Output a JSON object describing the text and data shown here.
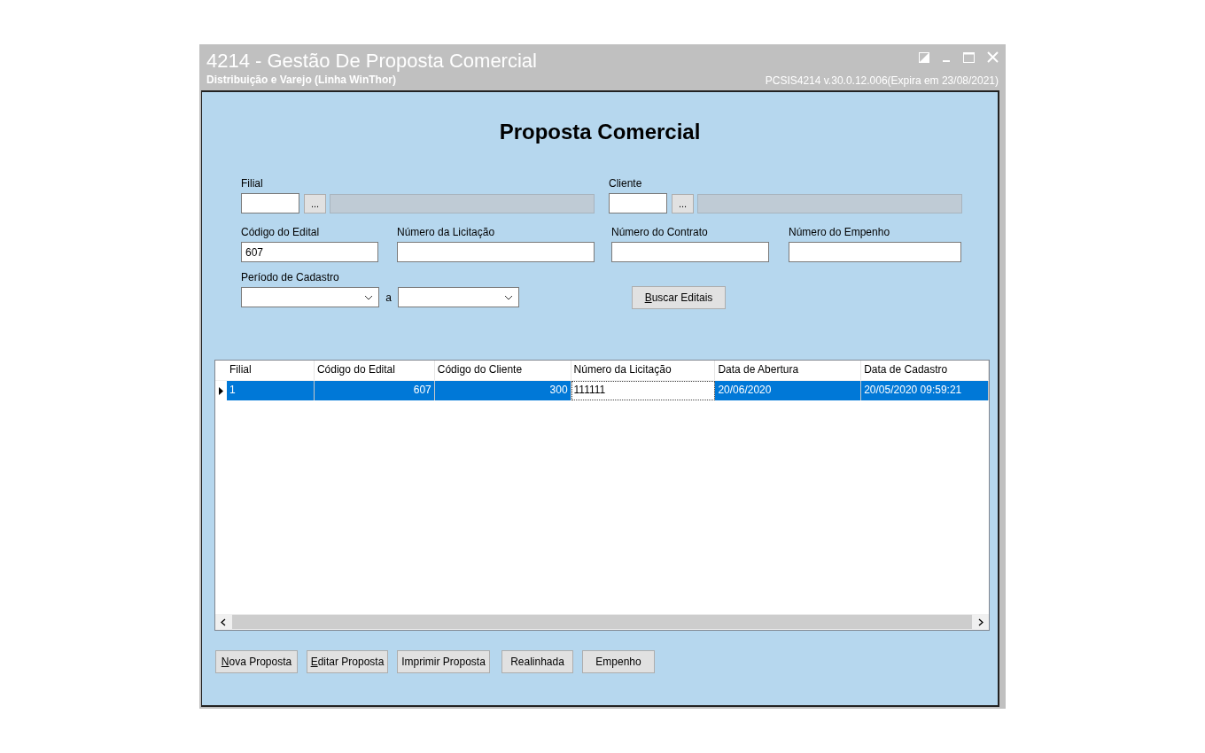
{
  "window": {
    "title": "4214 - Gestão De Proposta Comercial",
    "subtitle": "Distribuição e Varejo (Linha WinThor)",
    "version": "PCSIS4214  v.30.0.12.006(Expira em 23/08/2021)"
  },
  "heading": "Proposta Comercial",
  "lookups": [
    {
      "label": "Filial",
      "button": "..."
    },
    {
      "label": "Cliente",
      "button": "..."
    }
  ],
  "fields": [
    {
      "label": "Código do Edital",
      "value": "607"
    },
    {
      "label": "Número da Licitação"
    },
    {
      "label": "Número do Contrato"
    },
    {
      "label": "Número do Empenho"
    }
  ],
  "period": {
    "label": "Período de Cadastro",
    "separator": "a"
  },
  "search_button": {
    "label": "Buscar Editais",
    "accelerator": true
  },
  "table": {
    "columns": [
      {
        "label": "Filial",
        "kind": "text"
      },
      {
        "label": "Código do Edital",
        "kind": "number"
      },
      {
        "label": "Código do Cliente",
        "kind": "number"
      },
      {
        "label": "Número da Licitação",
        "kind": "text"
      },
      {
        "label": "Data de Abertura",
        "kind": "text"
      },
      {
        "label": "Data de Cadastro",
        "kind": "text"
      }
    ],
    "rows": [
      {
        "selected": true,
        "cells": [
          {
            "text": "1",
            "focused": false
          },
          {
            "text": "607",
            "focused": false
          },
          {
            "text": "300",
            "focused": false
          },
          {
            "text": "111111",
            "focused": true
          },
          {
            "text": "20/06/2020",
            "focused": false
          },
          {
            "text": "20/05/2020 09:59:21",
            "focused": false
          }
        ]
      }
    ]
  },
  "buttons": [
    {
      "label": "Nova Proposta",
      "accelerator": true
    },
    {
      "label": "Editar Proposta",
      "accelerator": true
    },
    {
      "label": "Imprimir Proposta",
      "accelerator": false
    },
    {
      "label": "Realinhada",
      "accelerator": false
    },
    {
      "label": "Empenho",
      "accelerator": false
    }
  ]
}
